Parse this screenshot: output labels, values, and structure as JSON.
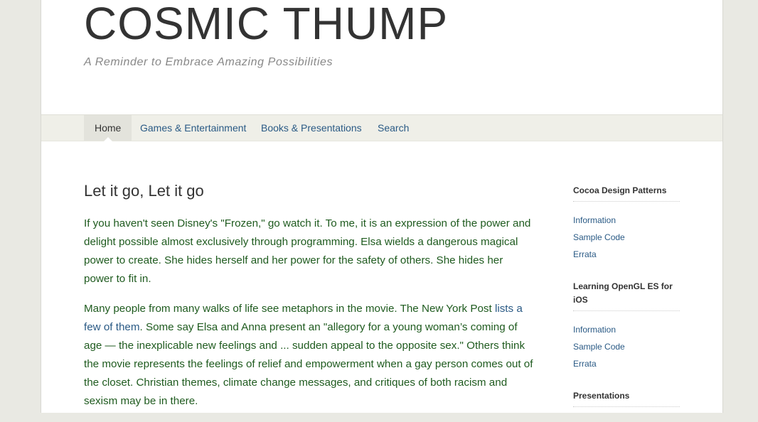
{
  "site": {
    "title": "COSMIC THUMP",
    "tagline": "A Reminder to Embrace Amazing Possibilities"
  },
  "nav": {
    "items": [
      {
        "label": "Home",
        "active": true
      },
      {
        "label": "Games & Entertainment"
      },
      {
        "label": "Books & Presentations"
      },
      {
        "label": "Search"
      }
    ]
  },
  "post": {
    "title": "Let it go, Let it go",
    "p1": "If you haven't seen Disney's \"Frozen,\" go watch it. To me, it is an expression of the power and delight possible almost exclusively through programming. Elsa wields a dangerous magical power to create. She hides herself and her power for the safety of others. She hides her power to fit in.",
    "p2_before": "Many people from many walks of life see metaphors in the movie. The New York Post ",
    "p2_link": "lists a few of them",
    "p2_after": ". Some say Elsa and Anna present an \"allegory for a young woman’s coming of age — the inexplicable new feelings and ... sudden appeal to the opposite sex.\" Others think the movie represents the feelings of relief and empowerment when a gay person comes out of the closet. Christian themes, climate change messages, and critiques of both racism and sexism may be in there."
  },
  "sidebar": {
    "widgets": [
      {
        "title": "Cocoa Design Patterns",
        "links": [
          "Information",
          "Sample Code",
          "Errata"
        ]
      },
      {
        "title": "Learning OpenGL ES for iOS",
        "links": [
          "Information",
          "Sample Code",
          "Errata"
        ]
      },
      {
        "title": "Presentations",
        "links": []
      }
    ]
  },
  "colors": {
    "body_text": "#1f5b1f",
    "link": "#2a5a85",
    "nav_bg": "#efefe8",
    "page_bg": "#e9e9e3"
  }
}
